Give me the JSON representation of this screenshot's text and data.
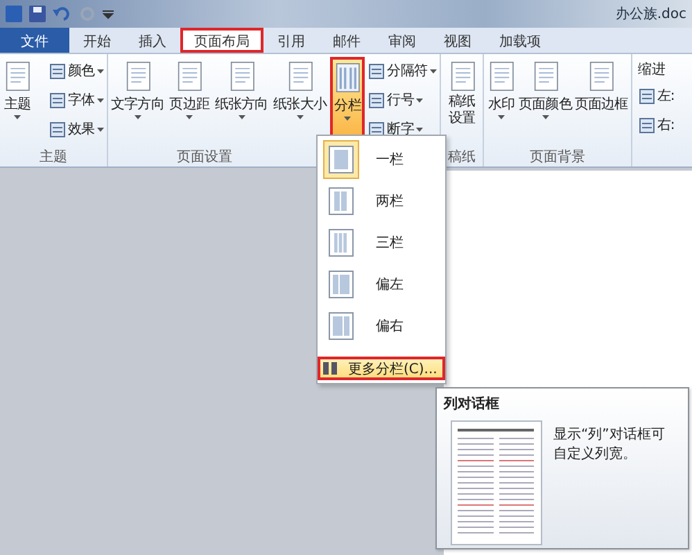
{
  "title_bar": {
    "title": "办公族.doc"
  },
  "tabs": [
    {
      "label": "文件",
      "kind": "file",
      "selected": false,
      "outlined": false
    },
    {
      "label": "开始",
      "kind": "tab",
      "selected": false,
      "outlined": false
    },
    {
      "label": "插入",
      "kind": "tab",
      "selected": false,
      "outlined": false
    },
    {
      "label": "页面布局",
      "kind": "tab",
      "selected": true,
      "outlined": true
    },
    {
      "label": "引用",
      "kind": "tab",
      "selected": false,
      "outlined": false
    },
    {
      "label": "邮件",
      "kind": "tab",
      "selected": false,
      "outlined": false
    },
    {
      "label": "审阅",
      "kind": "tab",
      "selected": false,
      "outlined": false
    },
    {
      "label": "视图",
      "kind": "tab",
      "selected": false,
      "outlined": false
    },
    {
      "label": "加载项",
      "kind": "tab",
      "selected": false,
      "outlined": false
    }
  ],
  "ribbon": {
    "groups": [
      {
        "label": "主题",
        "items": [
          {
            "kind": "large",
            "label": "主题",
            "pressed": false,
            "outlined": false,
            "dropdown": true
          },
          {
            "kind": "stack",
            "items": [
              {
                "label": "颜色",
                "dropdown": true
              },
              {
                "label": "字体",
                "dropdown": true
              },
              {
                "label": "效果",
                "dropdown": true
              }
            ]
          }
        ]
      },
      {
        "label": "页面设置",
        "items": [
          {
            "kind": "large",
            "label": "文字方向",
            "pressed": false,
            "outlined": false,
            "dropdown": true
          },
          {
            "kind": "large",
            "label": "页边距",
            "pressed": false,
            "outlined": false,
            "dropdown": true
          },
          {
            "kind": "large",
            "label": "纸张方向",
            "pressed": false,
            "outlined": false,
            "dropdown": true
          },
          {
            "kind": "large",
            "label": "纸张大小",
            "pressed": false,
            "outlined": false,
            "dropdown": true
          },
          {
            "kind": "large",
            "label": "分栏",
            "pressed": true,
            "outlined": true,
            "dropdown": true
          },
          {
            "kind": "stack",
            "items": [
              {
                "label": "分隔符",
                "dropdown": true
              },
              {
                "label": "行号",
                "dropdown": true
              },
              {
                "label": "断字",
                "dropdown": true
              }
            ]
          }
        ]
      },
      {
        "label": "稿纸",
        "items": [
          {
            "kind": "large",
            "label": "稿纸设置",
            "pressed": false,
            "outlined": false,
            "dropdown": false
          }
        ]
      },
      {
        "label": "页面背景",
        "items": [
          {
            "kind": "large",
            "label": "水印",
            "pressed": false,
            "outlined": false,
            "dropdown": true
          },
          {
            "kind": "large",
            "label": "页面颜色",
            "pressed": false,
            "outlined": false,
            "dropdown": true
          },
          {
            "kind": "large",
            "label": "页面边框",
            "pressed": false,
            "outlined": false,
            "dropdown": false
          }
        ]
      },
      {
        "heading": "缩进",
        "items": [
          {
            "kind": "stack",
            "items": [
              {
                "label": "左:",
                "dropdown": false
              },
              {
                "label": "右:",
                "dropdown": false
              }
            ]
          }
        ]
      }
    ]
  },
  "columns_menu": {
    "items": [
      {
        "label": "一栏",
        "selected": true
      },
      {
        "label": "两栏",
        "selected": false
      },
      {
        "label": "三栏",
        "selected": false
      },
      {
        "label": "偏左",
        "selected": false
      },
      {
        "label": "偏右",
        "selected": false
      }
    ],
    "footer": {
      "label": "更多分栏(C)...",
      "hovered": true,
      "outlined": true
    }
  },
  "tooltip": {
    "title": "列对话框",
    "text": "显示“列”对话框可自定义列宽。"
  }
}
